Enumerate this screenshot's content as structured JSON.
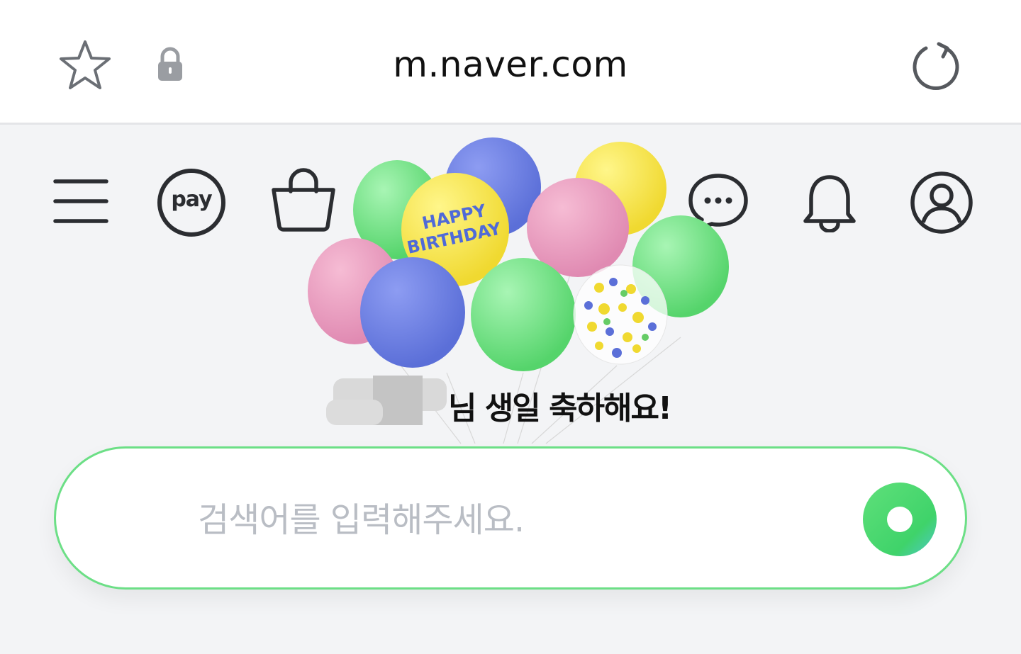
{
  "browser": {
    "url": "m.naver.com",
    "icons": {
      "bookmark": "star-outline-icon",
      "secure": "lock-icon",
      "reload": "reload-icon"
    }
  },
  "header": {
    "icons": {
      "menu": "hamburger-menu-icon",
      "pay": "pay-icon",
      "pay_label": "pay",
      "shopping": "shopping-bag-icon",
      "talk": "chat-bubble-icon",
      "notifications": "bell-icon",
      "profile": "user-circle-icon"
    }
  },
  "banner": {
    "balloon_text_line1": "HAPPY",
    "balloon_text_line2": "BIRTHDAY",
    "greeting_suffix": "님 생일 축하해요!"
  },
  "search": {
    "placeholder": "검색어를 입력해주세요.",
    "value": "",
    "accent_color": "#6cdf86"
  }
}
